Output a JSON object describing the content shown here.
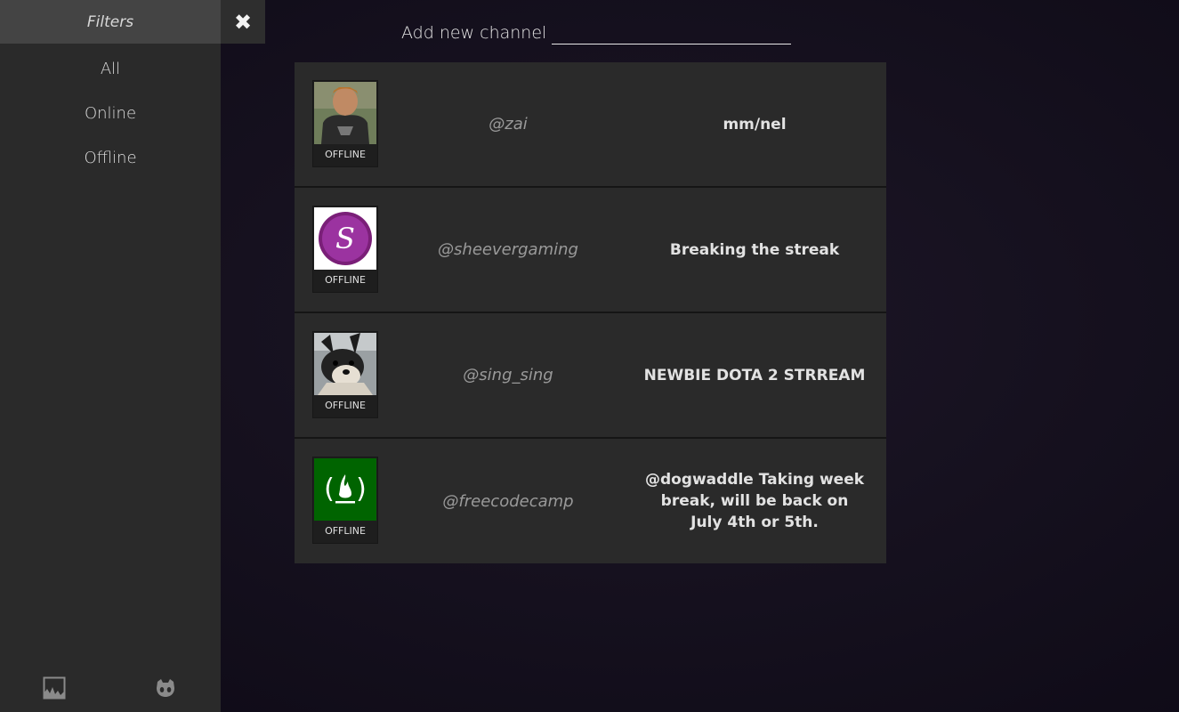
{
  "sidebar": {
    "header": "Filters",
    "close_symbol": "✖",
    "filters": [
      {
        "label": "All"
      },
      {
        "label": "Online"
      },
      {
        "label": "Offline"
      }
    ],
    "footer_icons": [
      "portfolio-icon",
      "github-icon"
    ]
  },
  "add_channel": {
    "label": "Add new channel",
    "value": ""
  },
  "channels": [
    {
      "handle": "@zai",
      "status": "OFFLINE",
      "title": "mm/nel",
      "logo": "zai-avatar"
    },
    {
      "handle": "@sheevergaming",
      "status": "OFFLINE",
      "title": "Breaking the streak",
      "logo": "sheever-logo"
    },
    {
      "handle": "@sing_sing",
      "status": "OFFLINE",
      "title": "NEWBIE DOTA 2 STRREAM",
      "logo": "dog-avatar"
    },
    {
      "handle": "@freecodecamp",
      "status": "OFFLINE",
      "title": "@dogwaddle Taking week break, will be back on July 4th or 5th.",
      "logo": "freecodecamp-logo"
    }
  ],
  "colors": {
    "sidebar_bg": "#2a2a2a",
    "header_bg": "#444444",
    "row_bg": "#2a2a2a",
    "freecodecamp_green": "#006400",
    "sheever_purple": "#8e2a8a"
  }
}
